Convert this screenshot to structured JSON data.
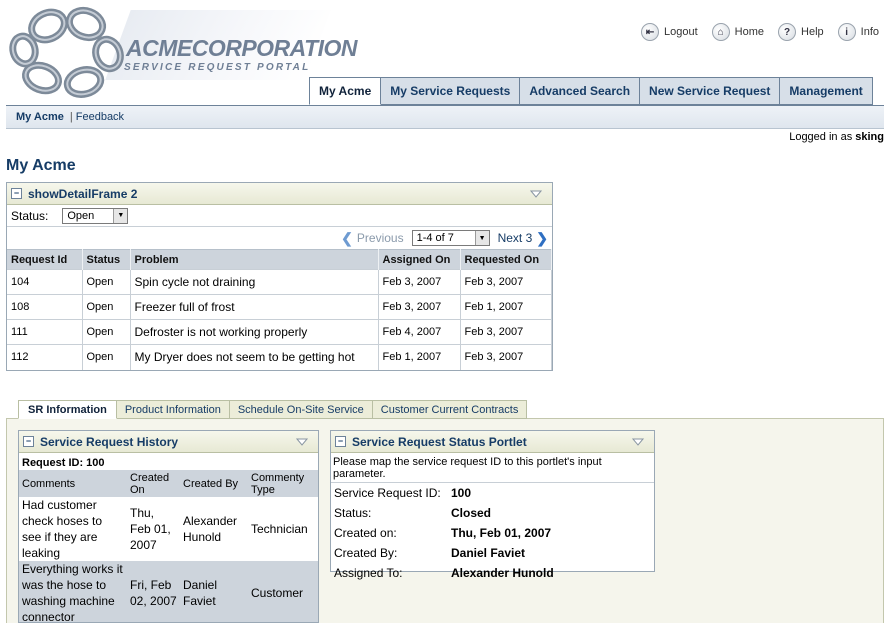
{
  "brand": {
    "name": "ACMECORPORATION",
    "tagline": "SERVICE REQUEST PORTAL"
  },
  "global_links": [
    {
      "label": "Logout",
      "icon": "logout-icon"
    },
    {
      "label": "Home",
      "icon": "home-icon"
    },
    {
      "label": "Help",
      "icon": "help-icon"
    },
    {
      "label": "Info",
      "icon": "info-icon"
    }
  ],
  "tabs": [
    {
      "label": "My Acme",
      "active": true
    },
    {
      "label": "My Service Requests"
    },
    {
      "label": "Advanced Search"
    },
    {
      "label": "New Service Request"
    },
    {
      "label": "Management"
    }
  ],
  "subnav": {
    "current": "My Acme",
    "separator": "|",
    "link": "Feedback"
  },
  "logged_in": {
    "prefix": "Logged in as",
    "user": "sking"
  },
  "page_title": "My Acme",
  "detail_frame": {
    "title": "showDetailFrame 2",
    "status_label": "Status:",
    "status_value": "Open",
    "pager": {
      "previous": "Previous",
      "range": "1-4 of 7",
      "next": "Next 3"
    },
    "columns": [
      "Request Id",
      "Status",
      "Problem",
      "Assigned On",
      "Requested On"
    ],
    "rows": [
      [
        "104",
        "Open",
        "Spin cycle not draining",
        "Feb 3, 2007",
        "Feb 3, 2007"
      ],
      [
        "108",
        "Open",
        "Freezer full of frost",
        "Feb 3, 2007",
        "Feb 1, 2007"
      ],
      [
        "111",
        "Open",
        "Defroster is not working properly",
        "Feb 4, 2007",
        "Feb 3, 2007"
      ],
      [
        "112",
        "Open",
        "My Dryer does not seem to be getting hot",
        "Feb 1, 2007",
        "Feb 3, 2007"
      ]
    ]
  },
  "lower_tabs": [
    {
      "label": "SR Information",
      "active": true
    },
    {
      "label": "Product Information"
    },
    {
      "label": "Schedule On-Site Service"
    },
    {
      "label": "Customer Current Contracts"
    }
  ],
  "history": {
    "title": "Service Request History",
    "request_id": "Request ID: 100",
    "columns": [
      "Comments",
      "Created On",
      "Created By",
      "Commenty Type"
    ],
    "rows": [
      [
        "Had customer check hoses to see if they are leaking",
        "Thu, Feb 01, 2007",
        "Alexander Hunold",
        "Technician"
      ],
      [
        "Everything works it was the hose to washing machine connector",
        "Fri, Feb 02, 2007",
        "Daniel Faviet",
        "Customer"
      ]
    ]
  },
  "status_portlet": {
    "title": "Service Request Status Portlet",
    "note": "Please map the service request ID to this portlet's input parameter.",
    "fields": [
      {
        "label": "Service Request ID:",
        "value": "100"
      },
      {
        "label": "Status:",
        "value": "Closed"
      },
      {
        "label": "Created on:",
        "value": "Thu, Feb 01, 2007"
      },
      {
        "label": "Created By:",
        "value": "Daniel Faviet"
      },
      {
        "label": "Assigned To:",
        "value": "Alexander Hunold"
      }
    ]
  }
}
